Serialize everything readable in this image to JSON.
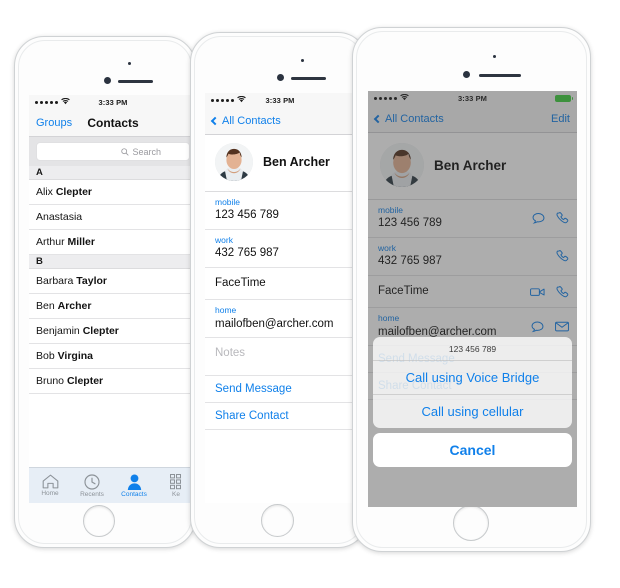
{
  "status_bar": {
    "signal_dots": 5,
    "wifi_icon": "wifi-icon",
    "time": "3:33 PM",
    "battery_color": "#3ecf3e"
  },
  "colors": {
    "accent_blue": "#1080ea",
    "label_blue": "#1080ea",
    "battery_green": "#3ecf3e",
    "section_header_bg": "#ededef",
    "tabbar_bg": "#e7eef6",
    "dim_overlay": "rgba(60,60,60,.42)"
  },
  "phone1": {
    "nav": {
      "left_label": "Groups",
      "title": "Contacts"
    },
    "search": {
      "placeholder": "Search",
      "icon": "search-icon",
      "value": ""
    },
    "sections": [
      {
        "letter": "A",
        "contacts": [
          {
            "first": "Alix",
            "last": "Clepter"
          },
          {
            "first": "Anastasia",
            "last": ""
          },
          {
            "first": "Arthur",
            "last": "Miller"
          }
        ]
      },
      {
        "letter": "B",
        "contacts": [
          {
            "first": "Barbara",
            "last": "Taylor"
          },
          {
            "first": "Ben",
            "last": "Archer"
          },
          {
            "first": "Benjamin",
            "last": "Clepter"
          },
          {
            "first": "Bob",
            "last": "Virgina"
          },
          {
            "first": "Bruno",
            "last": "Clepter"
          }
        ]
      }
    ],
    "tabs": [
      {
        "label": "Home",
        "icon": "home-icon",
        "active": false
      },
      {
        "label": "Recents",
        "icon": "clock-icon",
        "active": false
      },
      {
        "label": "Contacts",
        "icon": "person-icon",
        "active": true
      },
      {
        "label": "Ke",
        "icon": "keypad-icon",
        "active": false
      }
    ]
  },
  "phone2": {
    "nav": {
      "back_label": "All Contacts",
      "back_icon": "chevron-left-icon"
    },
    "contact": {
      "name": "Ben Archer",
      "avatar": "contact-photo",
      "fields": [
        {
          "label": "mobile",
          "value": "123 456 789"
        },
        {
          "label": "work",
          "value": "432 765 987"
        },
        {
          "label": "",
          "value": "FaceTime"
        },
        {
          "label": "home",
          "value": "mailofben@archer.com"
        },
        {
          "label": "",
          "value": "Notes",
          "muted": true
        }
      ],
      "actions": [
        {
          "label": "Send Message"
        },
        {
          "label": "Share Contact"
        }
      ]
    }
  },
  "phone3": {
    "nav": {
      "back_label": "All Contacts",
      "back_icon": "chevron-left-icon",
      "right_label": "Edit"
    },
    "contact": {
      "name": "Ben Archer",
      "avatar": "contact-photo",
      "fields": [
        {
          "label": "mobile",
          "value": "123 456 789",
          "icons": [
            "message-bubble-icon",
            "phone-handset-icon"
          ]
        },
        {
          "label": "work",
          "value": "432 765 987",
          "icons": [
            "phone-handset-icon"
          ]
        },
        {
          "label": "",
          "value": "FaceTime",
          "icons": [
            "video-camera-icon",
            "phone-handset-icon"
          ]
        },
        {
          "label": "home",
          "value": "mailofben@archer.com",
          "icons": [
            "message-bubble-icon",
            "mail-envelope-icon"
          ]
        }
      ],
      "actions": [
        {
          "label": "Send Message"
        },
        {
          "label": "Share Contact"
        }
      ]
    },
    "action_sheet": {
      "title": "123 456 789",
      "options": [
        {
          "label": "Call using Voice Bridge"
        },
        {
          "label": "Call using cellular"
        }
      ],
      "cancel_label": "Cancel"
    }
  }
}
